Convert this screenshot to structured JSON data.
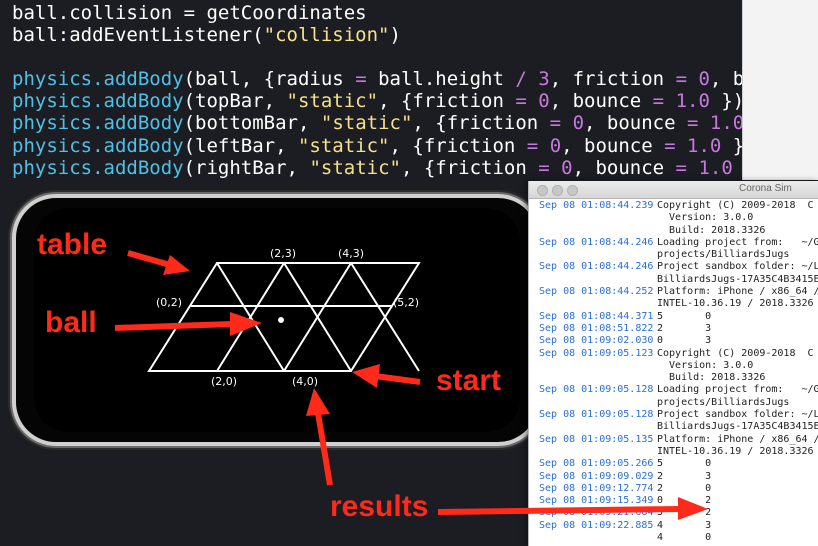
{
  "code_lines": [
    [
      {
        "t": "ball.collision = getCoordinates",
        "c": ""
      }
    ],
    [
      {
        "t": "ball:addEventListener(",
        "c": ""
      },
      {
        "t": "\"collision\"",
        "c": "str"
      },
      {
        "t": ")",
        "c": ""
      }
    ],
    [],
    [
      {
        "t": "physics.addBody",
        "c": "fn"
      },
      {
        "t": "(ball, {radius ",
        "c": ""
      },
      {
        "t": "=",
        "c": "op"
      },
      {
        "t": " ball.height ",
        "c": ""
      },
      {
        "t": "/",
        "c": "op"
      },
      {
        "t": " ",
        "c": ""
      },
      {
        "t": "3",
        "c": "num"
      },
      {
        "t": ", friction ",
        "c": ""
      },
      {
        "t": "=",
        "c": "op"
      },
      {
        "t": " ",
        "c": ""
      },
      {
        "t": "0",
        "c": "num"
      },
      {
        "t": ", bou",
        "c": ""
      }
    ],
    [
      {
        "t": "physics.addBody",
        "c": "fn"
      },
      {
        "t": "(topBar, ",
        "c": ""
      },
      {
        "t": "\"static\"",
        "c": "str"
      },
      {
        "t": ", {friction ",
        "c": ""
      },
      {
        "t": "=",
        "c": "op"
      },
      {
        "t": " ",
        "c": ""
      },
      {
        "t": "0",
        "c": "num"
      },
      {
        "t": ", bounce ",
        "c": ""
      },
      {
        "t": "=",
        "c": "op"
      },
      {
        "t": " ",
        "c": ""
      },
      {
        "t": "1.0",
        "c": "num"
      },
      {
        "t": " })",
        "c": ""
      }
    ],
    [
      {
        "t": "physics.addBody",
        "c": "fn"
      },
      {
        "t": "(bottomBar, ",
        "c": ""
      },
      {
        "t": "\"static\"",
        "c": "str"
      },
      {
        "t": ", {friction ",
        "c": ""
      },
      {
        "t": "=",
        "c": "op"
      },
      {
        "t": " ",
        "c": ""
      },
      {
        "t": "0",
        "c": "num"
      },
      {
        "t": ", bounce ",
        "c": ""
      },
      {
        "t": "=",
        "c": "op"
      },
      {
        "t": " ",
        "c": ""
      },
      {
        "t": "1.0",
        "c": "num"
      },
      {
        "t": " }",
        "c": ""
      }
    ],
    [
      {
        "t": "physics.addBody",
        "c": "fn"
      },
      {
        "t": "(leftBar, ",
        "c": ""
      },
      {
        "t": "\"static\"",
        "c": "str"
      },
      {
        "t": ", {friction ",
        "c": ""
      },
      {
        "t": "=",
        "c": "op"
      },
      {
        "t": " ",
        "c": ""
      },
      {
        "t": "0",
        "c": "num"
      },
      {
        "t": ", bounce ",
        "c": ""
      },
      {
        "t": "=",
        "c": "op"
      },
      {
        "t": " ",
        "c": ""
      },
      {
        "t": "1.0",
        "c": "num"
      },
      {
        "t": " })",
        "c": ""
      }
    ],
    [
      {
        "t": "physics.addBody",
        "c": "fn"
      },
      {
        "t": "(rightBar, ",
        "c": ""
      },
      {
        "t": "\"static\"",
        "c": "str"
      },
      {
        "t": ", {friction ",
        "c": ""
      },
      {
        "t": "=",
        "c": "op"
      },
      {
        "t": " ",
        "c": ""
      },
      {
        "t": "0",
        "c": "num"
      },
      {
        "t": ", bounce ",
        "c": ""
      },
      {
        "t": "=",
        "c": "op"
      },
      {
        "t": " ",
        "c": ""
      },
      {
        "t": "1.0",
        "c": "num"
      },
      {
        "t": " })",
        "c": ""
      }
    ]
  ],
  "game": {
    "labels": {
      "p02": "(0,2)",
      "p23": "(2,3)",
      "p43": "(4,3)",
      "p52": "(5,2)",
      "p20": "(2,0)",
      "p40": "(4,0)"
    }
  },
  "annotations": {
    "table": "table",
    "ball": "ball",
    "start": "start",
    "results": "results"
  },
  "console": {
    "title": "Corona Sim",
    "rows": [
      {
        "ts": "Sep 08 01:08:44.239",
        "msg": "Copyright (C) 2009-2018  C o"
      },
      {
        "ts": "",
        "msg": "  Version: 3.0.0"
      },
      {
        "ts": "",
        "msg": "  Build: 2018.3326"
      },
      {
        "ts": "Sep 08 01:08:44.246",
        "msg": "Loading project from:   ~/Go"
      },
      {
        "ts": "",
        "msg": "projects/BilliardsJugs"
      },
      {
        "ts": "Sep 08 01:08:44.246",
        "msg": "Project sandbox folder: ~/Li"
      },
      {
        "ts": "",
        "msg": "BilliardsJugs-17A35C4B3415E0"
      },
      {
        "ts": "Sep 08 01:08:44.252",
        "msg": "Platform: iPhone / x86_64 /"
      },
      {
        "ts": "",
        "msg": "INTEL-10.36.19 / 2018.3326 /"
      },
      {
        "ts": "Sep 08 01:08:44.371",
        "msg": "5       0"
      },
      {
        "ts": "Sep 08 01:08:51.822",
        "msg": "2       3"
      },
      {
        "ts": "Sep 08 01:09:02.030",
        "msg": "0       3"
      },
      {
        "ts": "Sep 08 01:09:05.123",
        "msg": "Copyright (C) 2009-2018  C o"
      },
      {
        "ts": "",
        "msg": "  Version: 3.0.0"
      },
      {
        "ts": "",
        "msg": "  Build: 2018.3326"
      },
      {
        "ts": "Sep 08 01:09:05.128",
        "msg": "Loading project from:   ~/Go"
      },
      {
        "ts": "",
        "msg": "projects/BilliardsJugs"
      },
      {
        "ts": "Sep 08 01:09:05.128",
        "msg": "Project sandbox folder: ~/Li"
      },
      {
        "ts": "",
        "msg": "BilliardsJugs-17A35C4B3415E0"
      },
      {
        "ts": "Sep 08 01:09:05.135",
        "msg": "Platform: iPhone / x86_64 /"
      },
      {
        "ts": "",
        "msg": "INTEL-10.36.19 / 2018.3326 /"
      },
      {
        "ts": "Sep 08 01:09:05.266",
        "msg": "5       0"
      },
      {
        "ts": "Sep 08 01:09:09.029",
        "msg": "2       3"
      },
      {
        "ts": "Sep 08 01:09:12.774",
        "msg": "2       0"
      },
      {
        "ts": "Sep 08 01:09:15.349",
        "msg": "0       2"
      },
      {
        "ts": "Sep 08 01:09:21.684",
        "msg": "5       2"
      },
      {
        "ts": "Sep 08 01:09:22.885",
        "msg": "4       3"
      },
      {
        "ts": "",
        "msg": "4       0"
      }
    ]
  },
  "colors": {
    "annotation": "#ff2a1a",
    "timestamp": "#2a6fd6",
    "keyword": "#4fc1e9",
    "string": "#f6e08a",
    "number": "#c678dd"
  }
}
